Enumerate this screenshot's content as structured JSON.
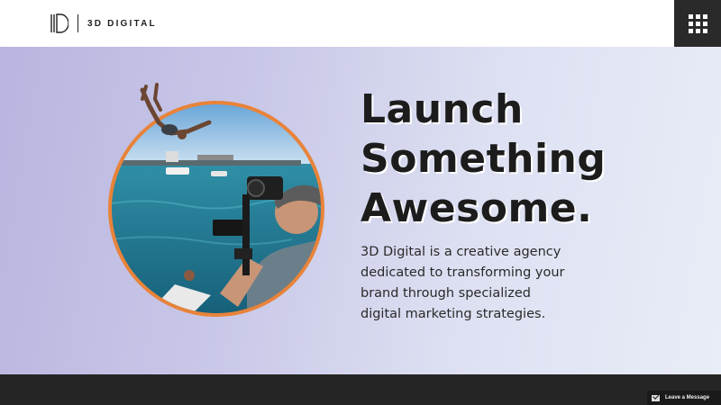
{
  "header": {
    "brand_name": "3D DIGITAL"
  },
  "hero": {
    "headline_lines": [
      "Launch",
      "Something",
      "Awesome."
    ],
    "description_lines": [
      "3D Digital is a creative agency",
      "dedicated to transforming your",
      "brand through specialized",
      "digital marketing strategies."
    ]
  },
  "footer": {
    "leave_message_label": "Leave a Message"
  },
  "colors": {
    "accent_ring": "#e8833a",
    "dark": "#252525",
    "hero_gradient_start": "#b9b5df",
    "hero_gradient_end": "#e9edf7"
  },
  "icons": [
    "logo-icon",
    "grid-menu-icon",
    "mail-icon"
  ]
}
